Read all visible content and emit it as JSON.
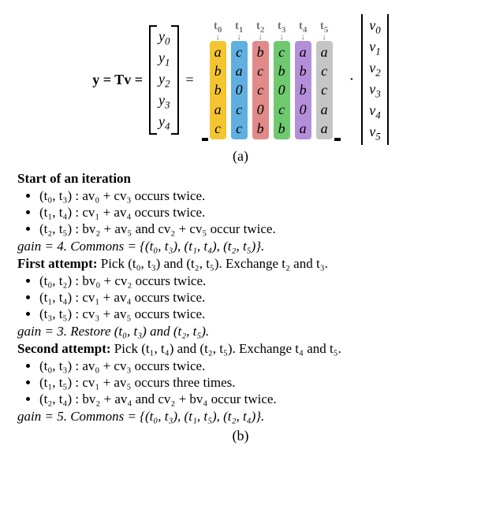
{
  "equation": {
    "lhs": "y = Tv =",
    "eq2": "=",
    "dot": "·"
  },
  "t_labels": [
    "t",
    "t",
    "t",
    "t",
    "t",
    "t"
  ],
  "t_subs": [
    "0",
    "1",
    "2",
    "3",
    "4",
    "5"
  ],
  "y_vec": [
    "y",
    "y",
    "y",
    "y",
    "y"
  ],
  "y_subs": [
    "0",
    "1",
    "2",
    "3",
    "4"
  ],
  "v_vec": [
    "v",
    "v",
    "v",
    "v",
    "v",
    "v"
  ],
  "v_subs": [
    "0",
    "1",
    "2",
    "3",
    "4",
    "5"
  ],
  "T_columns": [
    [
      "a",
      "b",
      "b",
      "a",
      "c"
    ],
    [
      "c",
      "a",
      "0",
      "c",
      "c"
    ],
    [
      "b",
      "c",
      "c",
      "0",
      "b"
    ],
    [
      "c",
      "b",
      "0",
      "c",
      "b"
    ],
    [
      "a",
      "b",
      "b",
      "0",
      "a"
    ],
    [
      "a",
      "c",
      "c",
      "a",
      "a"
    ]
  ],
  "caption_a": "(a)",
  "iter": {
    "start_title": "Start of an iteration",
    "start_items": [
      "(t₀, t₃) : av₀ + cv₃ occurs twice.",
      "(t₁, t₄) : cv₁ + av₄ occurs twice.",
      "(t₂, t₅) : bv₂ + av₅ and cv₂ + cv₅ occur twice."
    ],
    "start_gain": "gain = 4. Commons = {(t₀, t₃), (t₁, t₄), (t₂, t₅)}.",
    "first_title": "First attempt:",
    "first_action": " Pick (t₀, t₃) and (t₂, t₅). Exchange t₂ and t₃.",
    "first_items": [
      "(t₀, t₂) : bv₀ + cv₂ occurs twice.",
      "(t₁, t₄) : cv₁ + av₄ occurs twice.",
      "(t₃, t₅) : cv₃ + av₅ occurs twice."
    ],
    "first_gain": "gain = 3. Restore (t₀, t₃) and (t₂, t₅).",
    "second_title": "Second attempt:",
    "second_action": " Pick (t₁, t₄) and (t₂, t₅). Exchange t₄ and t₅.",
    "second_items": [
      "(t₀, t₃) : av₀ + cv₃ occurs twice.",
      "(t₁, t₅) : cv₁ + av₅ occurs three times.",
      "(t₂, t₄) : bv₂ + av₄ and cv₂ + bv₄ occur twice."
    ],
    "second_gain": "gain = 5. Commons = {(t₀, t₃), (t₁, t₅), (t₂, t₄)}."
  },
  "caption_b": "(b)",
  "chart_data": {
    "type": "table",
    "description": "Matrix-vector product y = T v with T a 5×6 symbolic matrix over {a,b,c,0}",
    "y": [
      "y0",
      "y1",
      "y2",
      "y3",
      "y4"
    ],
    "v": [
      "v0",
      "v1",
      "v2",
      "v3",
      "v4",
      "v5"
    ],
    "T_rows": [
      [
        "a",
        "c",
        "b",
        "c",
        "a",
        "a"
      ],
      [
        "b",
        "a",
        "c",
        "b",
        "b",
        "c"
      ],
      [
        "b",
        "0",
        "c",
        "0",
        "b",
        "c"
      ],
      [
        "a",
        "c",
        "0",
        "c",
        "0",
        "a"
      ],
      [
        "c",
        "c",
        "b",
        "b",
        "a",
        "a"
      ]
    ],
    "column_labels": [
      "t0",
      "t1",
      "t2",
      "t3",
      "t4",
      "t5"
    ],
    "iterations": [
      {
        "name": "start",
        "pairs": [
          [
            "t0",
            "t3"
          ],
          [
            "t1",
            "t4"
          ],
          [
            "t2",
            "t5"
          ]
        ],
        "gain": 4
      },
      {
        "name": "first_attempt",
        "swap": [
          "t2",
          "t3"
        ],
        "pairs": [
          [
            "t0",
            "t2"
          ],
          [
            "t1",
            "t4"
          ],
          [
            "t3",
            "t5"
          ]
        ],
        "gain": 3,
        "accepted": false
      },
      {
        "name": "second_attempt",
        "swap": [
          "t4",
          "t5"
        ],
        "pairs": [
          [
            "t0",
            "t3"
          ],
          [
            "t1",
            "t5"
          ],
          [
            "t2",
            "t4"
          ]
        ],
        "gain": 5,
        "accepted": true
      }
    ]
  }
}
